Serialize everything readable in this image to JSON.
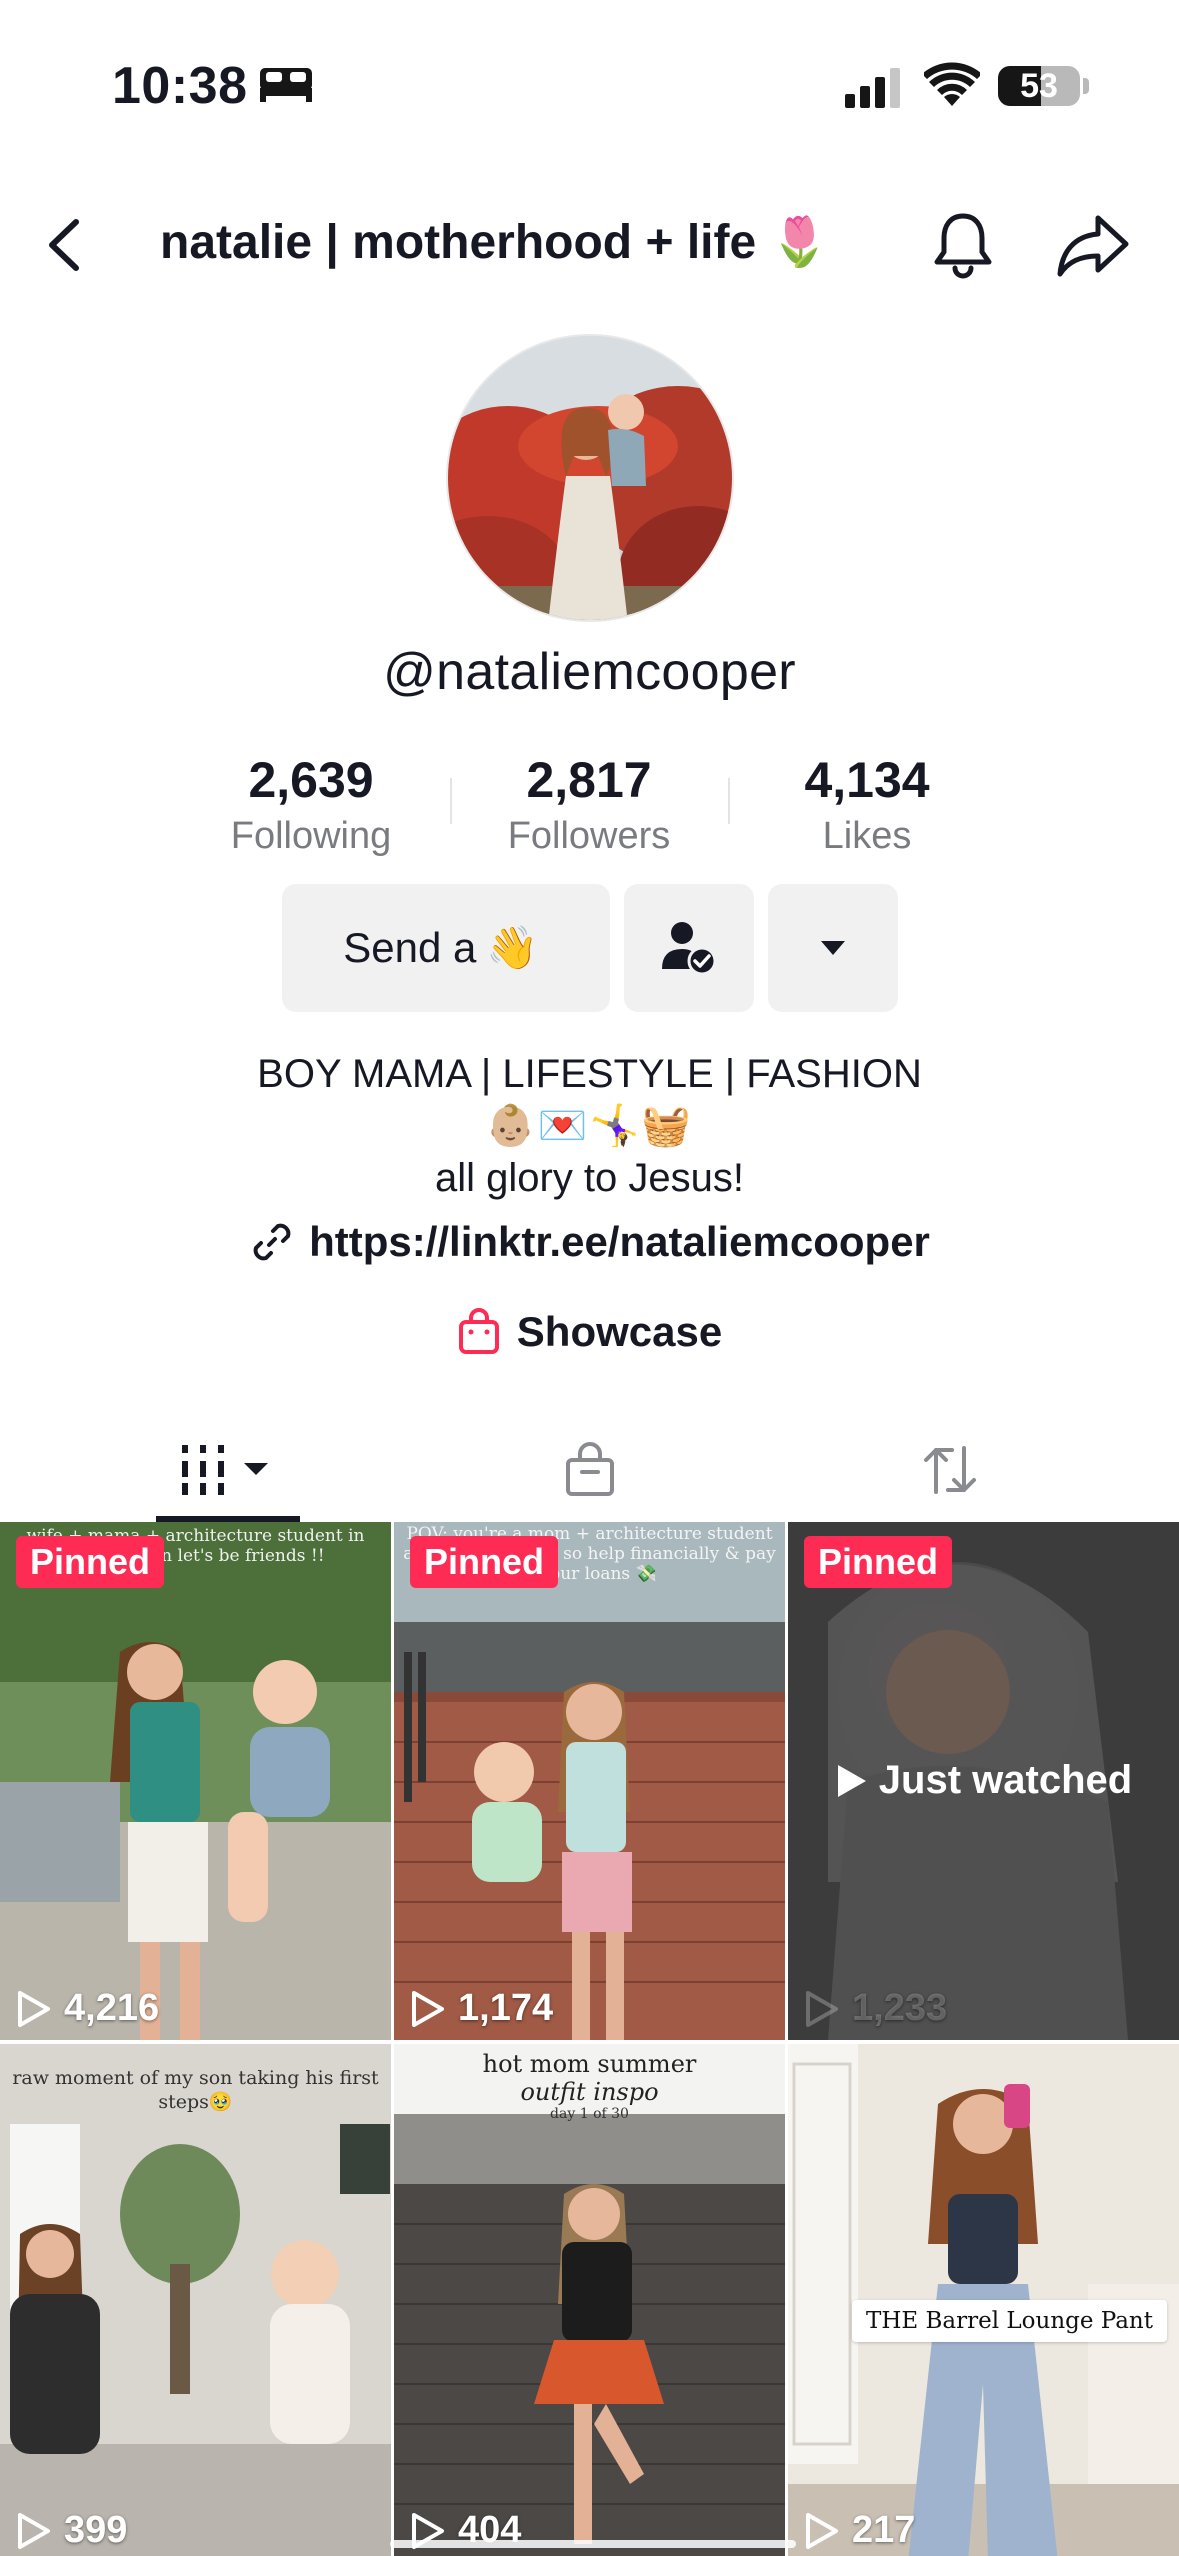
{
  "status_bar": {
    "time": "10:38",
    "battery_level": "53",
    "battery_fraction": 0.53,
    "icons": [
      "bed-icon",
      "signal-icon",
      "wifi-icon",
      "battery-icon"
    ]
  },
  "header": {
    "title": "natalie | motherhood + life 🌷",
    "icons": [
      "back-icon",
      "bell-icon",
      "share-icon"
    ]
  },
  "profile": {
    "username": "@nataliemcooper",
    "stats": [
      {
        "value": "2,639",
        "label": "Following"
      },
      {
        "value": "2,817",
        "label": "Followers"
      },
      {
        "value": "4,134",
        "label": "Likes"
      }
    ],
    "send_button": "Send a",
    "send_emoji": "👋",
    "bio_line1": "BOY MAMA | LIFESTYLE | FASHION",
    "bio_emojis": "👶🏼💌🤸‍♀️🧺",
    "bio_line3": "all glory to Jesus!",
    "link": "https://linktr.ee/nataliemcooper",
    "showcase": "Showcase"
  },
  "colors": {
    "accent": "#fe2c55",
    "text": "#161823",
    "muted": "#7a7b80",
    "button_bg": "#f1f1f2"
  },
  "tabs": [
    "videos-tab",
    "shop-tab",
    "reposts-tab"
  ],
  "videos": [
    {
      "pinned": "Pinned",
      "views": "4,216",
      "caption": "wife + mama + architecture student in knoxville, tn let's be friends !!"
    },
    {
      "pinned": "Pinned",
      "views": "1,174",
      "caption": "POV: you're a mom + architecture student amazing on tiktok so help financially & pay off our loans 💸"
    },
    {
      "pinned": "Pinned",
      "views": "1,233",
      "status": "Just watched"
    },
    {
      "views": "399",
      "caption": "raw moment of my son taking his first steps🥹"
    },
    {
      "views": "404",
      "caption_title": "hot mom summer",
      "caption_sub": "outfit inspo",
      "caption_day": "day 1 of 30"
    },
    {
      "views": "217",
      "caption": "THE Barrel Lounge Pant"
    }
  ]
}
